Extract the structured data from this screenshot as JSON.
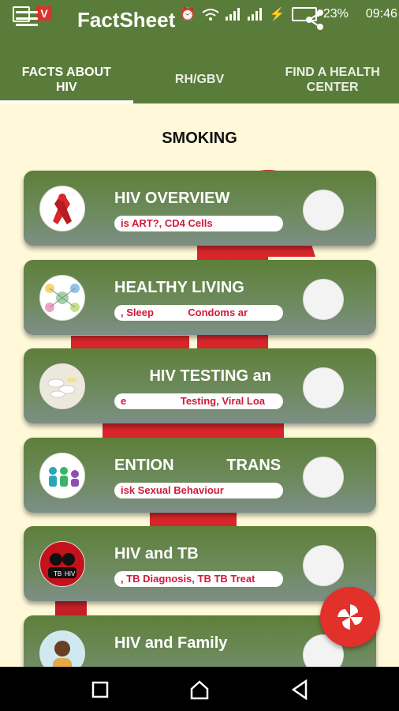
{
  "status_bar": {
    "battery_percent": "23%",
    "time": "09:46",
    "left_badge": "V"
  },
  "app": {
    "title": "FactSheet"
  },
  "tabs": [
    {
      "label": "FACTS ABOUT HIV",
      "active": true
    },
    {
      "label": "RH/GBV",
      "active": false
    },
    {
      "label": "FIND A HEALTH CENTER",
      "active": false
    }
  ],
  "section": {
    "title": "SMOKING"
  },
  "cards": [
    {
      "title": "HIV OVERVIEW",
      "subtitle": "is ART?, CD4 Cells",
      "thumb_icon": "red-ribbon-icon"
    },
    {
      "title": "HEALTHY LIVING",
      "subtitle": ", Sleep            Condoms ar",
      "thumb_icon": "mind-map-icon"
    },
    {
      "title": "        HIV TESTING an",
      "subtitle": "e                   Testing, Viral Loa",
      "thumb_icon": "pills-icon"
    },
    {
      "title": "ENTION            TRANS",
      "subtitle": "isk Sexual Behaviour",
      "thumb_icon": "family-icon"
    },
    {
      "title": "HIV and TB",
      "subtitle": ", TB Diagnosis, TB TB Treat",
      "thumb_icon": "tb-hiv-icon"
    },
    {
      "title": "HIV and Family",
      "subtitle": "",
      "thumb_icon": "person-icon"
    }
  ],
  "colors": {
    "primary": "#5a7c3a",
    "accent": "#e2302a",
    "background": "#fff8d9"
  }
}
